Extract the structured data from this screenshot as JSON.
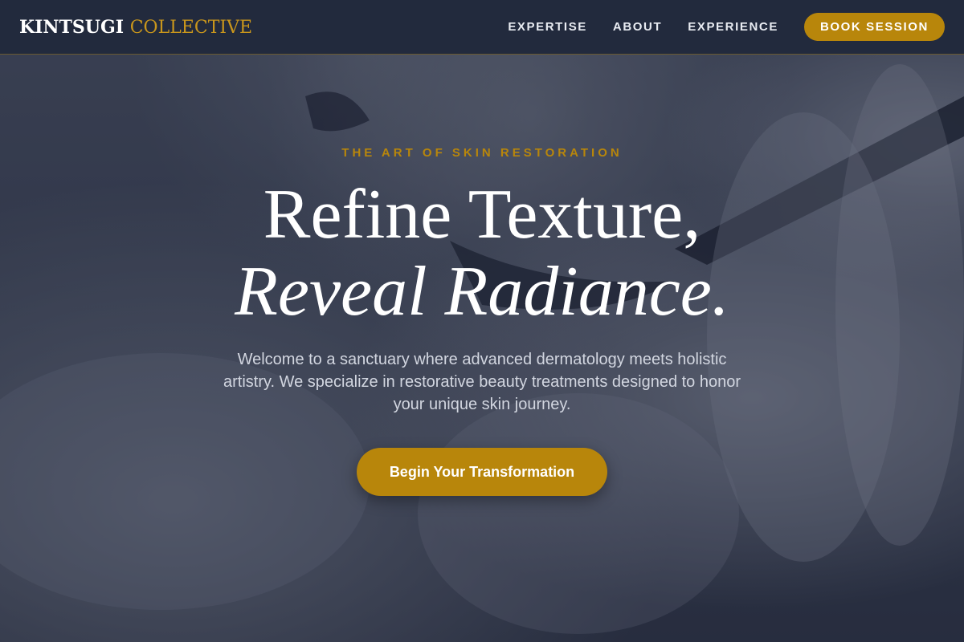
{
  "brand": {
    "name_part1": "KINTSUGI",
    "name_part2": "COLLECTIVE"
  },
  "nav": {
    "items": [
      {
        "label": "EXPERTISE"
      },
      {
        "label": "ABOUT"
      },
      {
        "label": "EXPERIENCE"
      }
    ],
    "cta_label": "BOOK SESSION"
  },
  "hero": {
    "eyebrow": "THE ART OF SKIN RESTORATION",
    "headline_line1": "Refine Texture,",
    "headline_line2": "Reveal Radiance.",
    "intro": "Welcome to a sanctuary where advanced dermatology meets holistic artistry. We specialize in restorative beauty treatments designed to honor your unique skin journey.",
    "cta_label": "Begin Your Transformation"
  },
  "colors": {
    "header_bg": "#222a3d",
    "accent_gold": "#b8860b",
    "text_white": "#ffffff"
  }
}
